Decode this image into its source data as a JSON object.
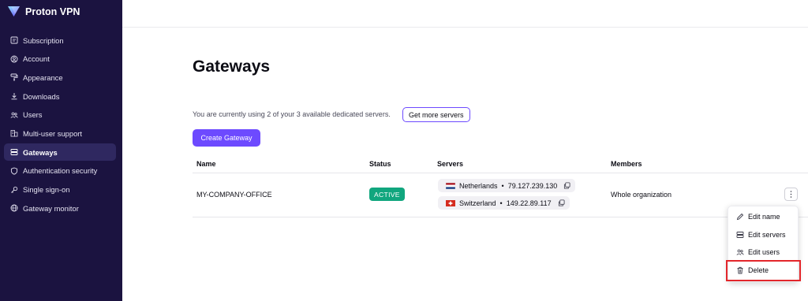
{
  "app": {
    "name": "Proton VPN"
  },
  "sidebar": {
    "items": [
      {
        "label": "Subscription",
        "icon": "subscription-icon"
      },
      {
        "label": "Account",
        "icon": "account-icon"
      },
      {
        "label": "Appearance",
        "icon": "paint-roller-icon"
      },
      {
        "label": "Downloads",
        "icon": "download-icon"
      },
      {
        "label": "Users",
        "icon": "users-icon"
      },
      {
        "label": "Multi-user support",
        "icon": "buildings-icon"
      },
      {
        "label": "Gateways",
        "icon": "servers-icon",
        "active": true
      },
      {
        "label": "Authentication security",
        "icon": "shield-icon"
      },
      {
        "label": "Single sign-on",
        "icon": "key-icon"
      },
      {
        "label": "Gateway monitor",
        "icon": "globe-icon"
      }
    ]
  },
  "page": {
    "title": "Gateways",
    "usage_text": "You are currently using 2 of your 3 available dedicated servers.",
    "get_more_label": "Get more servers",
    "create_label": "Create Gateway"
  },
  "table": {
    "columns": [
      "Name",
      "Status",
      "Servers",
      "Members"
    ],
    "rows": [
      {
        "name": "MY-COMPANY-OFFICE",
        "status": "ACTIVE",
        "servers": [
          {
            "country": "Netherlands",
            "ip": "79.127.239.130",
            "flag": "netherlands-flag-icon"
          },
          {
            "country": "Switzerland",
            "ip": "149.22.89.117",
            "flag": "switzerland-flag-icon"
          }
        ],
        "members": "Whole organization"
      }
    ]
  },
  "menu": {
    "items": [
      {
        "label": "Edit name",
        "icon": "pencil-icon"
      },
      {
        "label": "Edit servers",
        "icon": "servers-icon"
      },
      {
        "label": "Edit users",
        "icon": "users-icon"
      },
      {
        "label": "Delete",
        "icon": "trash-icon",
        "highlighted": true
      }
    ]
  },
  "colors": {
    "sidebar_bg": "#1b1340",
    "sidebar_active": "#2f2860",
    "accent": "#6d4aff",
    "status_active": "#11a67e",
    "highlight": "#e3262b"
  },
  "separator": "•"
}
